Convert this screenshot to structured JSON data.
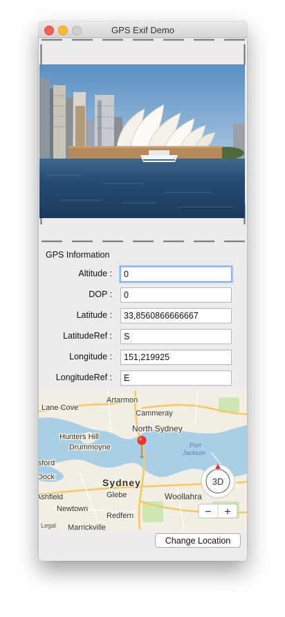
{
  "window": {
    "title": "GPS Exif Demo"
  },
  "section_title": "GPS Information",
  "fields": [
    {
      "label": "Altitude :",
      "value": "0"
    },
    {
      "label": "DOP :",
      "value": "0"
    },
    {
      "label": "Latitude :",
      "value": "33,8560866666667"
    },
    {
      "label": "LatitudeRef :",
      "value": "S"
    },
    {
      "label": "Longitude :",
      "value": "151,219925"
    },
    {
      "label": "LongitudeRef :",
      "value": "E"
    }
  ],
  "map": {
    "labels": [
      "Lane Cove",
      "Artarmon",
      "Cammeray",
      "North Sydney",
      "Hunters Hill",
      "Drummoyne",
      "Port",
      "Jackson",
      "Abbotsford",
      "Five Dock",
      "Sydney",
      "Glebe",
      "Woollahra",
      "Ashfield",
      "Newtown",
      "Redfern",
      "Marrickville",
      "Legal"
    ],
    "button_3d": "3D",
    "zoom_out": "−",
    "zoom_in": "+"
  },
  "change_location": "Change Location"
}
